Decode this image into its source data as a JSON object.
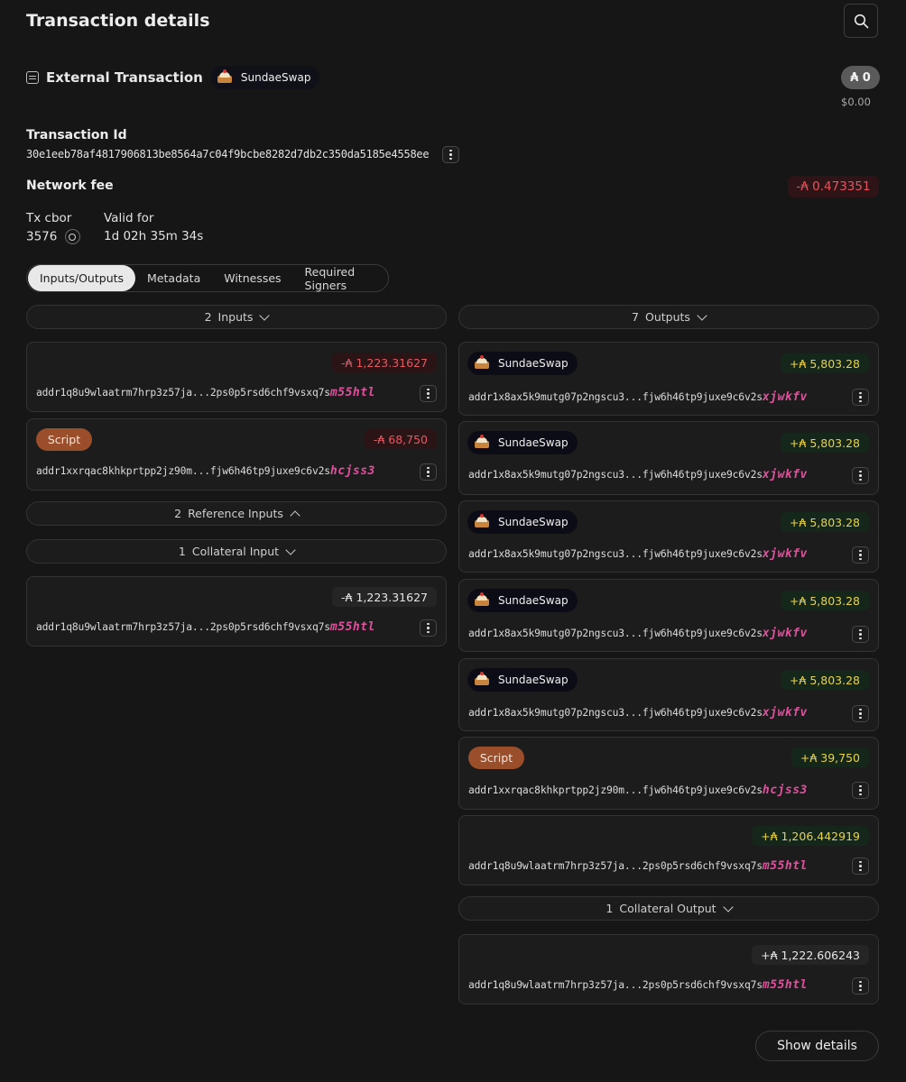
{
  "header": {
    "title": "Transaction details"
  },
  "external": {
    "label": "External Transaction",
    "dapp": "SundaeSwap",
    "ada_amount": "₳ 0",
    "usd_amount": "$0.00"
  },
  "transaction_id": {
    "label": "Transaction Id",
    "value": "30e1eeb78af4817906813be8564a7c04f9bcbe8282d7db2c350da5185e4558ee"
  },
  "network_fee": {
    "label": "Network fee",
    "value": "-₳ 0.473351"
  },
  "tx_cbor": {
    "label": "Tx cbor",
    "value": "3576"
  },
  "valid_for": {
    "label": "Valid for",
    "value": "1d 02h 35m 34s"
  },
  "tabs": [
    {
      "label": "Inputs/Outputs",
      "active": true
    },
    {
      "label": "Metadata"
    },
    {
      "label": "Witnesses"
    },
    {
      "label": "Required Signers"
    }
  ],
  "inputs": {
    "count": "2",
    "label": "Inputs",
    "items": [
      {
        "amount": "-₳ 1,223.31627",
        "addr": "addr1q8u9wlaatrm7hrp3z57ja...2ps0p5rsd6chf9vsxq7s",
        "suffix": "m55htl"
      },
      {
        "tag": "Script",
        "amount": "-₳ 68,750",
        "addr": "addr1xxrqac8khkprtpp2jz90m...fjw6h46tp9juxe9c6v2s",
        "suffix": "hcjss3"
      }
    ]
  },
  "reference_inputs": {
    "count": "2",
    "label": "Reference Inputs"
  },
  "collateral_input": {
    "count": "1",
    "label": "Collateral Input",
    "items": [
      {
        "amount": "-₳ 1,223.31627",
        "addr": "addr1q8u9wlaatrm7hrp3z57ja...2ps0p5rsd6chf9vsxq7s",
        "suffix": "m55htl"
      }
    ]
  },
  "outputs": {
    "count": "7",
    "label": "Outputs",
    "items": [
      {
        "dapp": "SundaeSwap",
        "amount": "+₳ 5,803.28",
        "addr": "addr1x8ax5k9mutg07p2ngscu3...fjw6h46tp9juxe9c6v2s",
        "suffix": "xjwkfv"
      },
      {
        "dapp": "SundaeSwap",
        "amount": "+₳ 5,803.28",
        "addr": "addr1x8ax5k9mutg07p2ngscu3...fjw6h46tp9juxe9c6v2s",
        "suffix": "xjwkfv"
      },
      {
        "dapp": "SundaeSwap",
        "amount": "+₳ 5,803.28",
        "addr": "addr1x8ax5k9mutg07p2ngscu3...fjw6h46tp9juxe9c6v2s",
        "suffix": "xjwkfv"
      },
      {
        "dapp": "SundaeSwap",
        "amount": "+₳ 5,803.28",
        "addr": "addr1x8ax5k9mutg07p2ngscu3...fjw6h46tp9juxe9c6v2s",
        "suffix": "xjwkfv"
      },
      {
        "dapp": "SundaeSwap",
        "amount": "+₳ 5,803.28",
        "addr": "addr1x8ax5k9mutg07p2ngscu3...fjw6h46tp9juxe9c6v2s",
        "suffix": "xjwkfv"
      },
      {
        "tag": "Script",
        "amount": "+₳ 39,750",
        "addr": "addr1xxrqac8khkprtpp2jz90m...fjw6h46tp9juxe9c6v2s",
        "suffix": "hcjss3"
      },
      {
        "amount": "+₳ 1,206.442919",
        "addr": "addr1q8u9wlaatrm7hrp3z57ja...2ps0p5rsd6chf9vsxq7s",
        "suffix": "m55htl"
      }
    ]
  },
  "collateral_output": {
    "count": "1",
    "label": "Collateral Output",
    "items": [
      {
        "amount": "+₳ 1,222.606243",
        "addr": "addr1q8u9wlaatrm7hrp3z57ja...2ps0p5rsd6chf9vsxq7s",
        "suffix": "m55htl"
      }
    ]
  },
  "footer": {
    "show_details": "Show details"
  }
}
